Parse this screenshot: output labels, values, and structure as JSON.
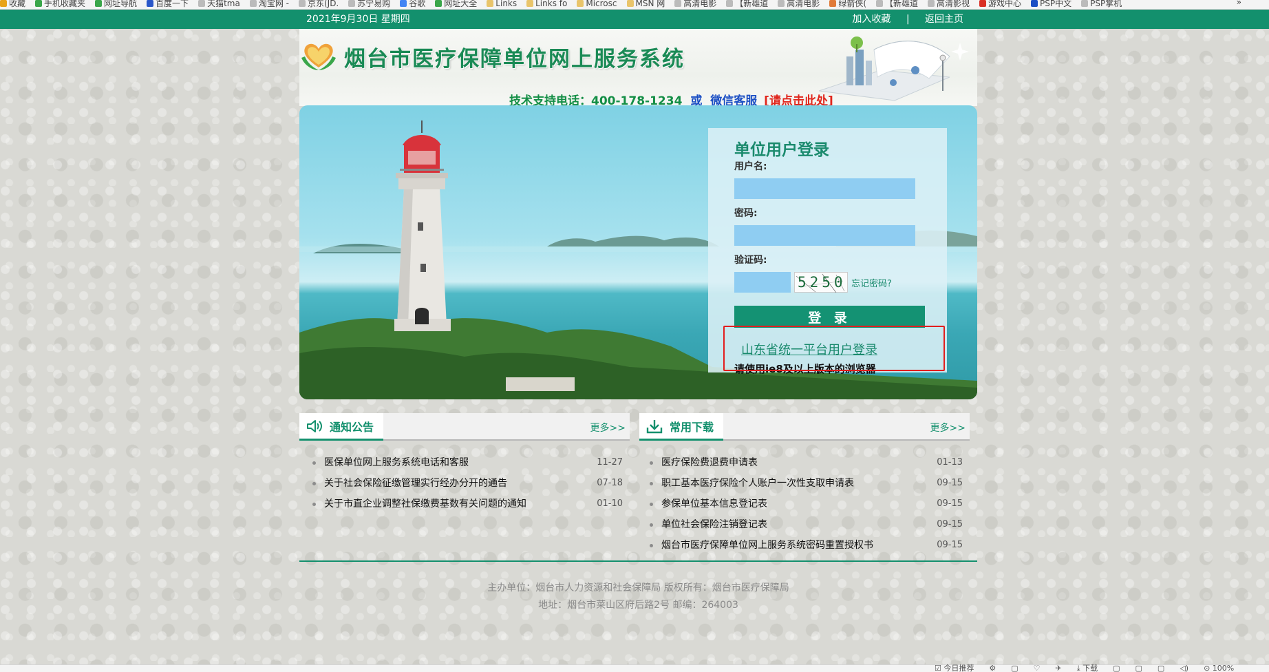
{
  "browser": {
    "favorites": [
      {
        "label": "收藏",
        "icon": "star-icon",
        "color": "#e8a317"
      },
      {
        "label": "手机收藏夹",
        "icon": "page-icon",
        "color": "#3aa64a"
      },
      {
        "label": "网址导航",
        "icon": "globe-icon",
        "color": "#3aa64a"
      },
      {
        "label": "百度一下",
        "icon": "paw-icon",
        "color": "#2a57c9"
      },
      {
        "label": "天猫tma",
        "icon": "page-icon",
        "color": "#bbbbbb"
      },
      {
        "label": "淘宝网 -",
        "icon": "page-icon",
        "color": "#bbbbbb"
      },
      {
        "label": "京东(JD.",
        "icon": "page-icon",
        "color": "#bbbbbb"
      },
      {
        "label": "苏宁易购",
        "icon": "page-icon",
        "color": "#bbbbbb"
      },
      {
        "label": "谷歌",
        "icon": "google-icon",
        "color": "#4285f4"
      },
      {
        "label": "网址大全",
        "icon": "globe-icon",
        "color": "#3aa64a"
      },
      {
        "label": "Links",
        "icon": "folder-icon",
        "color": "#e9c46a"
      },
      {
        "label": "Links fo",
        "icon": "folder-icon",
        "color": "#e9c46a"
      },
      {
        "label": "Microsc",
        "icon": "folder-icon",
        "color": "#e9c46a"
      },
      {
        "label": "MSN 网",
        "icon": "folder-icon",
        "color": "#e9c46a"
      },
      {
        "label": "高清电影",
        "icon": "page-icon",
        "color": "#bbbbbb"
      },
      {
        "label": "【新雄道",
        "icon": "page-icon",
        "color": "#bbbbbb"
      },
      {
        "label": "高清电影",
        "icon": "page-icon",
        "color": "#bbbbbb"
      },
      {
        "label": "绿箭侠(",
        "icon": "page-icon",
        "color": "#e07b39"
      },
      {
        "label": "【新雄道",
        "icon": "page-icon",
        "color": "#bbbbbb"
      },
      {
        "label": "高清影视",
        "icon": "page-icon",
        "color": "#bbbbbb"
      },
      {
        "label": "游戏中心",
        "icon": "game-icon",
        "color": "#d93025"
      },
      {
        "label": "PSP中文",
        "icon": "tg-icon",
        "color": "#1b4fc4"
      },
      {
        "label": "PSP掌机",
        "icon": "page-icon",
        "color": "#bbbbbb"
      }
    ],
    "favorites_more": "»",
    "status_items": [
      "☑ 今日推荐",
      "⚙",
      "▢",
      "♡",
      "✈",
      "⤓ 下载",
      "▢",
      "▢",
      "▢",
      "◁)",
      "⊙ 100%"
    ]
  },
  "topbar": {
    "date": "2021年9月30日 星期四",
    "add_favorite": "加入收藏",
    "separator": "|",
    "back_home": "返回主页"
  },
  "header": {
    "title": "烟台市医疗保障单位网上服务系统",
    "support_tel": "技术支持电话：400-178-1234",
    "support_or": "或",
    "support_wechat": "微信客服",
    "support_click": "[请点击此处]"
  },
  "login": {
    "title": "单位用户登录",
    "username_label": "用户名:",
    "password_label": "密码:",
    "captcha_label": "验证码:",
    "captcha_code": "5250",
    "forgot_password": "忘记密码?",
    "login_button": "登 录",
    "shandong_login": "山东省统一平台用户登录",
    "browser_note": "请使用ie8及以上版本的浏览器"
  },
  "notices": {
    "title": "通知公告",
    "more": "更多>>",
    "items": [
      {
        "title": "医保单位网上服务系统电话和客服",
        "date": "11-27"
      },
      {
        "title": "关于社会保险征缴管理实行经办分开的通告",
        "date": "07-18"
      },
      {
        "title": "关于市直企业调整社保缴费基数有关问题的通知",
        "date": "01-10"
      }
    ]
  },
  "downloads": {
    "title": "常用下载",
    "more": "更多>>",
    "items": [
      {
        "title": "医疗保险费退费申请表",
        "date": "01-13"
      },
      {
        "title": "职工基本医疗保险个人账户一次性支取申请表",
        "date": "09-15"
      },
      {
        "title": "参保单位基本信息登记表",
        "date": "09-15"
      },
      {
        "title": "单位社会保险注销登记表",
        "date": "09-15"
      },
      {
        "title": "烟台市医疗保障单位网上服务系统密码重置授权书",
        "date": "09-15"
      }
    ]
  },
  "footer": {
    "line1": "主办单位：烟台市人力资源和社会保障局 版权所有：烟台市医疗保障局",
    "line2": "地址：烟台市莱山区府后路2号 邮编：264003"
  },
  "colors": {
    "brand_green": "#13906d",
    "input_blue": "#8fcdf2",
    "highlight_red": "#e21d1d"
  }
}
